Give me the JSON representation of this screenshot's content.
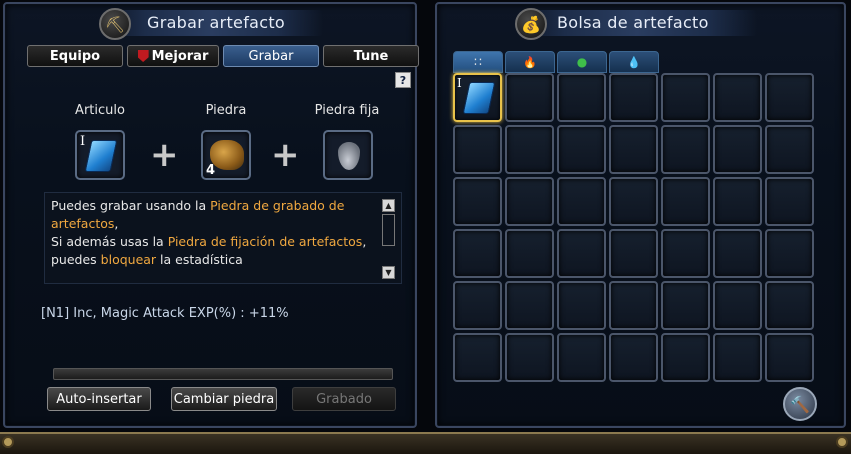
{
  "engrave_panel": {
    "title": "Grabar artefacto",
    "title_icon": "pickaxe-icon",
    "tabs": [
      {
        "label": "Equipo",
        "active": false
      },
      {
        "label": "Mejorar",
        "active": false,
        "icon": "shield-icon"
      },
      {
        "label": "Grabar",
        "active": true
      },
      {
        "label": "Tune",
        "active": false
      }
    ],
    "help_label": "?",
    "slots": {
      "artifact_label": "Articulo",
      "artifact_grade": "I",
      "stone_label": "Piedra",
      "stone_count": "4",
      "fixed_label": "Piedra fija"
    },
    "description": {
      "line1_a": "Puedes grabar usando la ",
      "line1_hl": "Piedra de grabado de artefactos",
      "line1_b": ",",
      "line2_a": "Si además usas la ",
      "line2_hl": "Piedra de fijación de artefactos",
      "line2_b": ", puedes ",
      "line2_hl2": "bloquear",
      "line2_c": " la estadística"
    },
    "stat_line": "[N1] Inc, Magic Attack EXP(%) : +11%",
    "progress": 0,
    "buttons": {
      "auto_insert": "Auto-insertar",
      "change_stone": "Cambiar piedra",
      "engrave": "Grabado"
    }
  },
  "bag_panel": {
    "title": "Bolsa de artefacto",
    "title_icon": "bag-icon",
    "tabs": [
      {
        "icon": "grid-icon",
        "glyph": "∷",
        "active": true
      },
      {
        "icon": "fire-icon",
        "glyph": "🔥",
        "active": false
      },
      {
        "icon": "leaf-icon",
        "glyph": "●",
        "active": false
      },
      {
        "icon": "water-drop-icon",
        "glyph": "💧",
        "active": false
      }
    ],
    "selected_item_grade": "I",
    "tool_icon": "hammer-icon"
  },
  "colors": {
    "highlight": "#f0a840",
    "selected_border": "#e8c24a",
    "active_tab": "#2f5584"
  }
}
